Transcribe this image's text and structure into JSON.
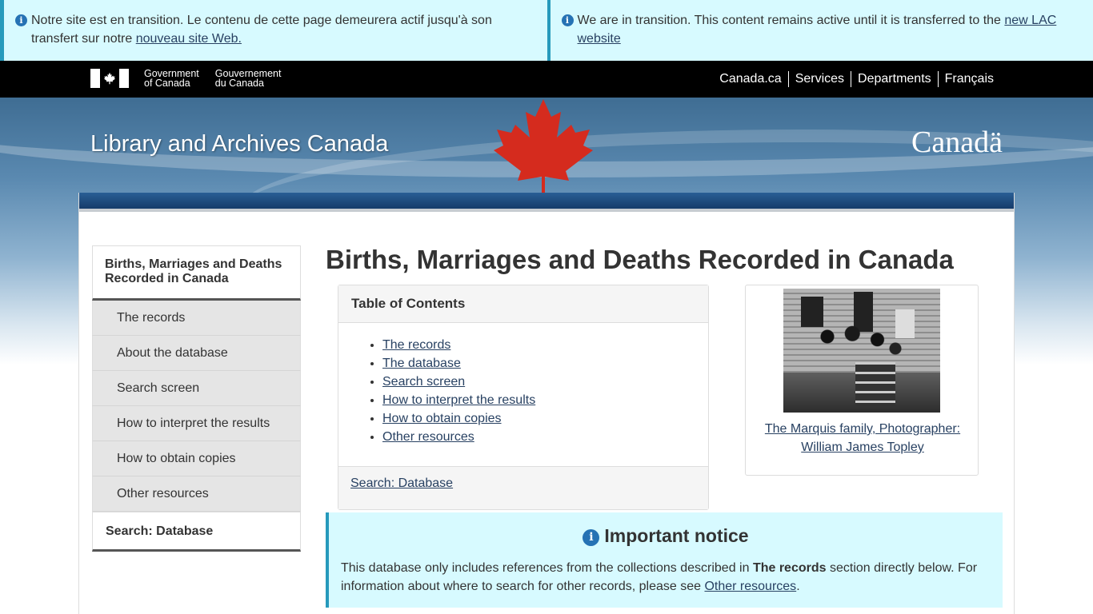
{
  "banners": {
    "fr": {
      "text": "Notre site est en transition. Le contenu de cette page demeurera actif jusqu'à son transfert sur notre ",
      "link": "nouveau site Web."
    },
    "en": {
      "text": "We are in transition. This content remains active until it is transferred to the ",
      "link": "new LAC website"
    }
  },
  "govbar": {
    "sig_en_1": "Government",
    "sig_en_2": "of Canada",
    "sig_fr_1": "Gouvernement",
    "sig_fr_2": "du Canada",
    "nav": [
      "Canada.ca",
      "Services",
      "Departments",
      "Français"
    ]
  },
  "site_title": "Library and Archives Canada",
  "wordmark": "Canadä",
  "sidebar": {
    "heading": "Births, Marriages and Deaths Recorded in Canada",
    "items": [
      "The records",
      "About the database",
      "Search screen",
      "How to interpret the results",
      "How to obtain copies",
      "Other resources"
    ],
    "footer": "Search: Database"
  },
  "page_title": "Births, Marriages and Deaths Recorded in Canada",
  "toc": {
    "heading": "Table of Contents",
    "items": [
      "The records",
      "The database",
      "Search screen",
      "How to interpret the results",
      "How to obtain copies",
      "Other resources"
    ],
    "footer_link": "Search: Database"
  },
  "photo": {
    "caption": "The Marquis family, Photographer: William James Topley"
  },
  "notice": {
    "title": "Important notice",
    "body_1": "This database only includes references from the collections described in ",
    "body_bold": "The records",
    "body_2": " section directly below. For information about where to search for other records, please see ",
    "body_link": "Other resources",
    "body_3": "."
  },
  "colors": {
    "banner_bg": "#d7faff",
    "banner_border": "#269abc",
    "link": "#284162",
    "maple_red": "#d52b1e"
  }
}
